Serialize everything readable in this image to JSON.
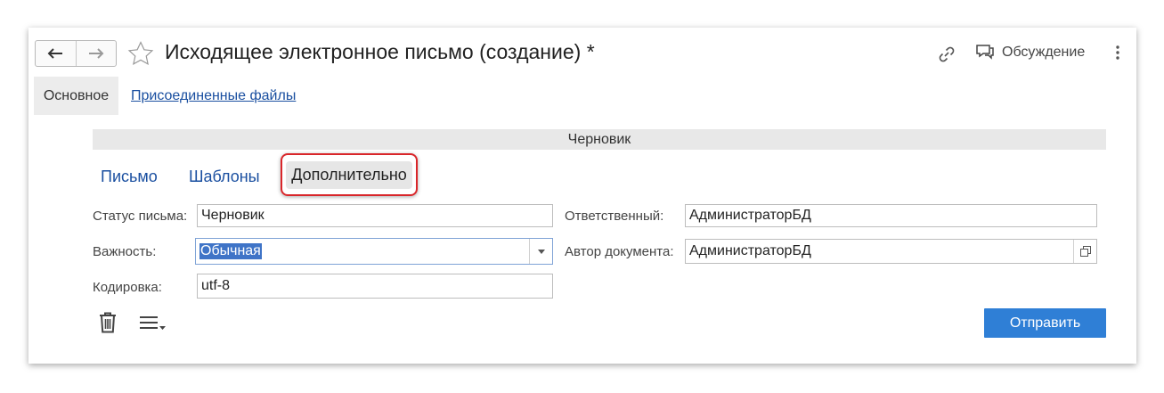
{
  "window": {
    "title": "Исходящее электронное письмо (создание) *",
    "discussion_label": "Обсуждение",
    "icons": {
      "back": "arrow-left-icon",
      "forward": "arrow-right-icon",
      "favorite": "star-icon",
      "link": "link-icon",
      "discussion": "chat-icon",
      "more": "more-vertical-icon"
    }
  },
  "page_tabs": [
    {
      "label": "Основное",
      "active": true
    },
    {
      "label": "Присоединенные файлы",
      "active": false
    }
  ],
  "status_bar": {
    "text": "Черновик"
  },
  "form_tabs": [
    {
      "label": "Письмо",
      "active": false
    },
    {
      "label": "Шаблоны",
      "active": false
    },
    {
      "label": "Дополнительно",
      "active": true
    }
  ],
  "fields": {
    "status": {
      "label": "Статус письма:",
      "value": "Черновик"
    },
    "importance": {
      "label": "Важность:",
      "value": "Обычная"
    },
    "encoding": {
      "label": "Кодировка:",
      "value": "utf-8"
    },
    "responsible": {
      "label": "Ответственный:",
      "value": "АдминистраторБД"
    },
    "author": {
      "label": "Автор документа:",
      "value": "АдминистраторБД"
    }
  },
  "footer": {
    "send_label": "Отправить",
    "icons": {
      "delete": "trash-icon",
      "menu": "menu-icon"
    }
  },
  "colors": {
    "accent": "#2f7fd6",
    "link": "#1a4fa0",
    "highlight_border": "#d9262a",
    "selection": "#3f74c7"
  }
}
